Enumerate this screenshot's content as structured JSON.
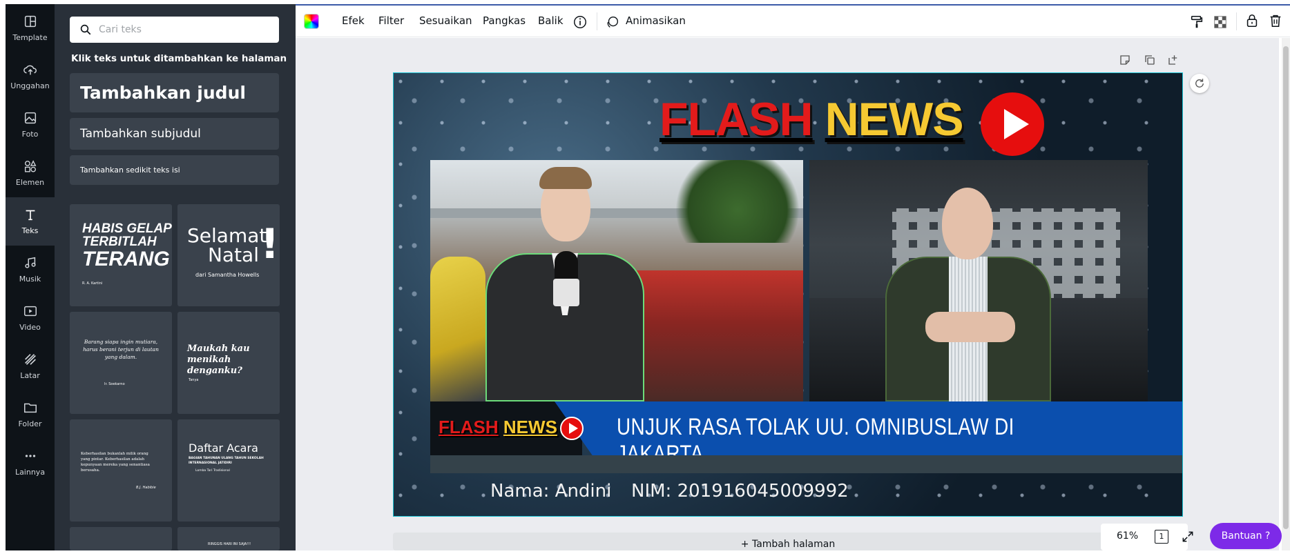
{
  "rail": {
    "items": [
      {
        "label": "Template",
        "icon": "template-icon"
      },
      {
        "label": "Unggahan",
        "icon": "upload-cloud-icon"
      },
      {
        "label": "Foto",
        "icon": "photo-icon"
      },
      {
        "label": "Elemen",
        "icon": "elements-shapes-icon"
      },
      {
        "label": "Teks",
        "icon": "text-icon"
      },
      {
        "label": "Musik",
        "icon": "music-note-icon"
      },
      {
        "label": "Video",
        "icon": "video-icon"
      },
      {
        "label": "Latar",
        "icon": "background-stripes-icon"
      },
      {
        "label": "Folder",
        "icon": "folder-icon"
      },
      {
        "label": "Lainnya",
        "icon": "more-dots-icon"
      }
    ],
    "active": "Teks"
  },
  "panel": {
    "search_placeholder": "Cari teks",
    "hint": "Klik teks untuk ditambahkan ke halaman",
    "heading_button": "Tambahkan judul",
    "subheading_button": "Tambahkan subjudul",
    "body_button": "Tambahkan sedikit teks isi",
    "templates": [
      {
        "line1": "HABIS GELAP",
        "line2": "TERBITLAH",
        "line3": "TERANG",
        "small": "R. A. Kartini"
      },
      {
        "line1": "Selamat",
        "line2": "Natal",
        "mark": "!",
        "small": "dari Samantha Howells"
      },
      {
        "line1": "Barang siapa ingin mutiara,",
        "line2": "harus berani terjun di lautan",
        "line3": "yang dalam.",
        "small": "Ir. Soekarno"
      },
      {
        "line1": "Maukah kau",
        "line2": "menikah denganku?",
        "small": "Tanya"
      },
      {
        "line1": "Keberhasilan bukanlah milik orang",
        "line2": "yang pintar. Keberhasilan adalah",
        "line3": "kepunyaan mereka yang senantiasa berusaha.",
        "small": "B.J. Habibie"
      },
      {
        "line1": "Daftar Acara",
        "line2": "BAGIAN TAHUNAN ULANG TAHUN SEKOLAH",
        "line3": "INTERNASIONAL JATIDIRI",
        "small": "Lomba Tari Tradisional"
      },
      {
        "line1": "",
        "small": ""
      },
      {
        "line1": "RINGGIS HARI INI SAJA!!!",
        "small": ""
      }
    ]
  },
  "toolbar": {
    "color_swatch": "color-swatch",
    "efek": "Efek",
    "filter": "Filter",
    "sesuaikan": "Sesuaikan",
    "pangkas": "Pangkas",
    "balik": "Balik",
    "animasikan": "Animasikan"
  },
  "design": {
    "title_flash": "FLASH",
    "title_news": "NEWS",
    "ticker_flash": "FLASH",
    "ticker_news": "NEWS",
    "ticker_text": "UNJUK RASA TOLAK UU. OMNIBUSLAW DI JAKARTA",
    "name": "Nama: Andini",
    "nim": "NIM: 201916045009992",
    "colors": {
      "red": "#e31b1b",
      "yellow": "#f6c932",
      "blue": "#0b4fae",
      "border": "#17c1d2"
    }
  },
  "footer": {
    "add_page": "+ Tambah halaman",
    "zoom": "61%",
    "page_count": "1",
    "help": "Bantuan  ?"
  }
}
